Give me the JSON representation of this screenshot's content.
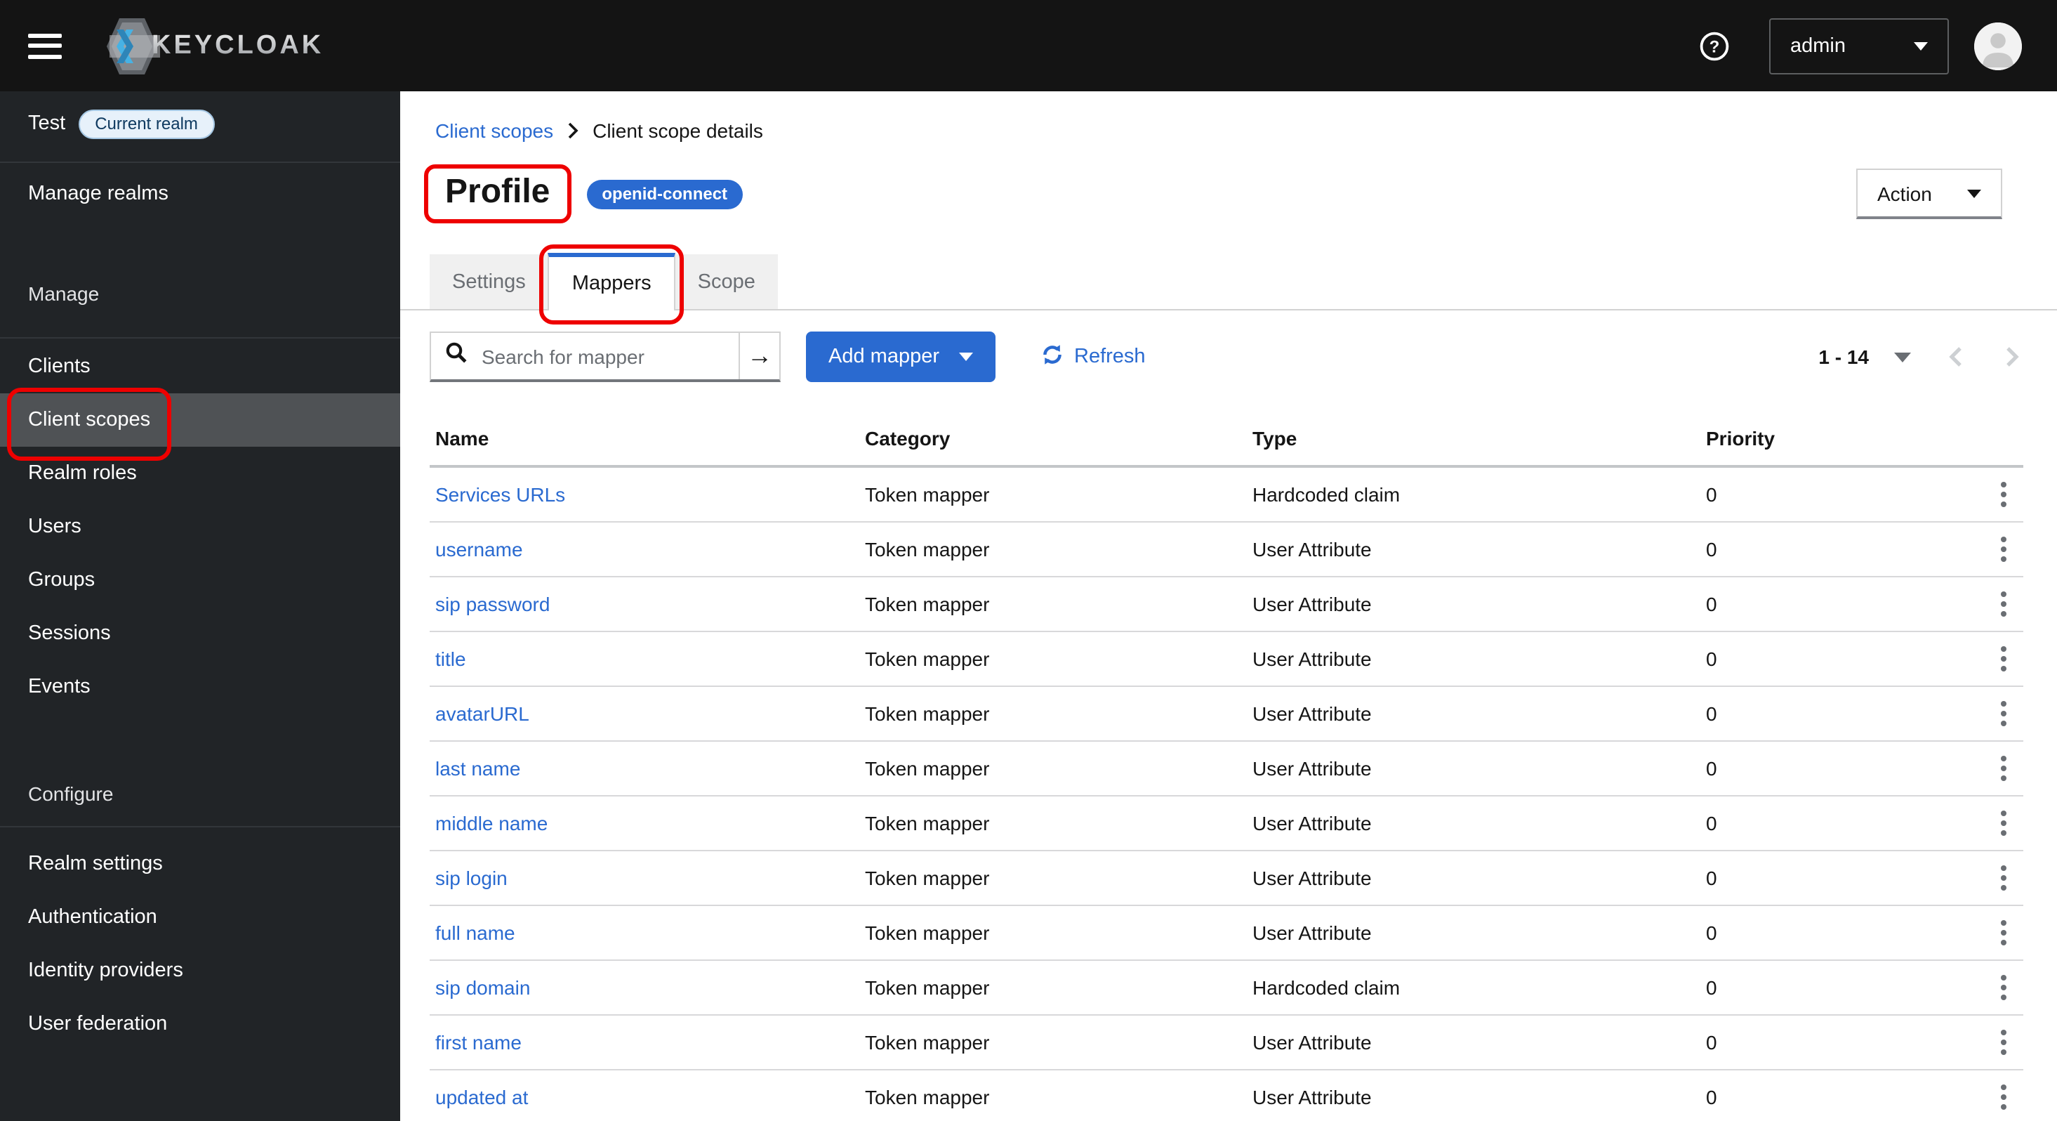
{
  "masthead": {
    "brand": "KEYCLOAK",
    "user_menu": "admin"
  },
  "sidebar": {
    "realm": {
      "name": "Test",
      "badge": "Current realm"
    },
    "manage_realms": "Manage realms",
    "sections": [
      {
        "label": "Manage",
        "items": [
          {
            "label": "Clients"
          },
          {
            "label": "Client scopes",
            "selected": true,
            "annotated": true
          },
          {
            "label": "Realm roles"
          },
          {
            "label": "Users"
          },
          {
            "label": "Groups"
          },
          {
            "label": "Sessions"
          },
          {
            "label": "Events"
          }
        ]
      },
      {
        "label": "Configure",
        "items": [
          {
            "label": "Realm settings"
          },
          {
            "label": "Authentication"
          },
          {
            "label": "Identity providers"
          },
          {
            "label": "User federation"
          }
        ]
      }
    ]
  },
  "breadcrumb": {
    "link": "Client scopes",
    "current": "Client scope details"
  },
  "header": {
    "title": "Profile",
    "protocol_badge": "openid-connect",
    "action_label": "Action"
  },
  "tabs": [
    {
      "label": "Settings"
    },
    {
      "label": "Mappers",
      "active": true,
      "annotated": true
    },
    {
      "label": "Scope"
    }
  ],
  "toolbar": {
    "search_placeholder": "Search for mapper",
    "add_button": "Add mapper",
    "refresh_label": "Refresh",
    "pagination": {
      "range": "1 - 14"
    }
  },
  "table": {
    "columns": {
      "name": "Name",
      "category": "Category",
      "type": "Type",
      "priority": "Priority"
    },
    "rows": [
      {
        "name": "Services URLs",
        "category": "Token mapper",
        "type": "Hardcoded claim",
        "priority": "0"
      },
      {
        "name": "username",
        "category": "Token mapper",
        "type": "User Attribute",
        "priority": "0"
      },
      {
        "name": "sip password",
        "category": "Token mapper",
        "type": "User Attribute",
        "priority": "0"
      },
      {
        "name": "title",
        "category": "Token mapper",
        "type": "User Attribute",
        "priority": "0"
      },
      {
        "name": "avatarURL",
        "category": "Token mapper",
        "type": "User Attribute",
        "priority": "0"
      },
      {
        "name": "last name",
        "category": "Token mapper",
        "type": "User Attribute",
        "priority": "0"
      },
      {
        "name": "middle name",
        "category": "Token mapper",
        "type": "User Attribute",
        "priority": "0"
      },
      {
        "name": "sip login",
        "category": "Token mapper",
        "type": "User Attribute",
        "priority": "0"
      },
      {
        "name": "full name",
        "category": "Token mapper",
        "type": "User Attribute",
        "priority": "0"
      },
      {
        "name": "sip domain",
        "category": "Token mapper",
        "type": "Hardcoded claim",
        "priority": "0"
      },
      {
        "name": "first name",
        "category": "Token mapper",
        "type": "User Attribute",
        "priority": "0"
      },
      {
        "name": "updated at",
        "category": "Token mapper",
        "type": "User Attribute",
        "priority": "0"
      }
    ]
  },
  "icons": [
    "hamburger-icon",
    "keycloak-logo-icon",
    "question-circle-icon",
    "chevron-down-icon",
    "avatar-icon",
    "breadcrumb-chevron-icon",
    "search-icon",
    "arrow-right-icon",
    "refresh-icon",
    "chevron-left-icon",
    "chevron-right-icon",
    "kebab-icon"
  ],
  "colors": {
    "accent_blue": "#2a6ad0",
    "annotation_red": "#ee0000",
    "masthead_bg": "#141414",
    "sidebar_bg": "#212427",
    "sidebar_selected_bg": "#4f5255",
    "tab_inactive_bg": "#f0f0f0",
    "realm_badge_bg": "#e7f1fa",
    "realm_badge_border": "#a6c8e4",
    "realm_badge_text": "#0f3a60"
  }
}
